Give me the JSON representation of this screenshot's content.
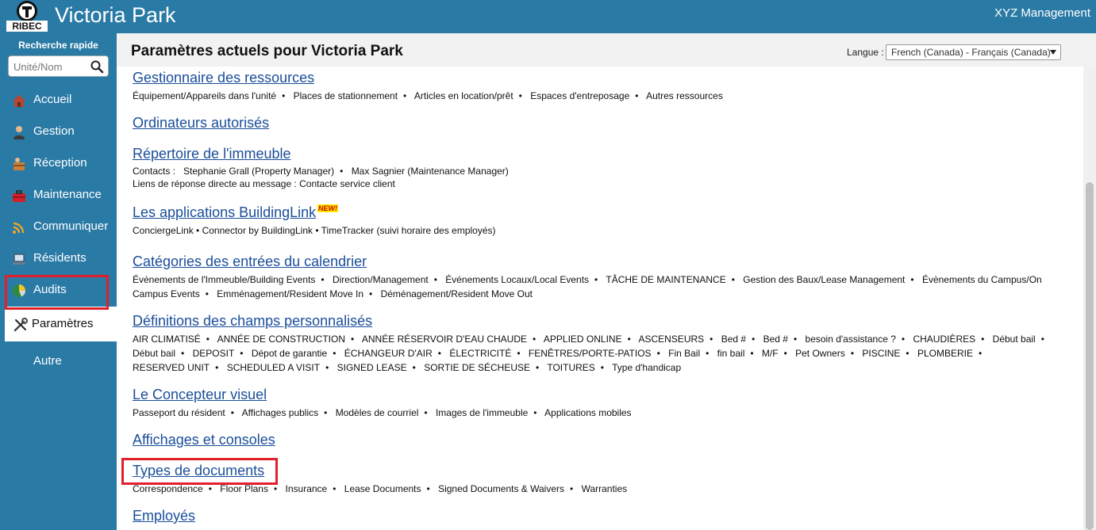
{
  "header": {
    "logo_text": "RIBEC",
    "title": "Victoria Park",
    "management": "XYZ Management"
  },
  "sidebar": {
    "quick_search_label": "Recherche rapide",
    "search_placeholder": "Unité/Nom",
    "items": [
      {
        "label": "Accueil",
        "icon": "house-icon"
      },
      {
        "label": "Gestion",
        "icon": "person-icon"
      },
      {
        "label": "Réception",
        "icon": "package-icon"
      },
      {
        "label": "Maintenance",
        "icon": "toolbox-icon"
      },
      {
        "label": "Communiquer",
        "icon": "wifi-icon"
      },
      {
        "label": "Résidents",
        "icon": "laptop-icon"
      },
      {
        "label": "Audits",
        "icon": "pie-chart-icon"
      },
      {
        "label": "Paramètres",
        "icon": "tools-icon",
        "active": true
      },
      {
        "label": "Autre",
        "icon": ""
      }
    ]
  },
  "content": {
    "title": "Paramètres actuels pour Victoria Park",
    "language_label": "Langue :",
    "language_value": "French (Canada) - Français (Canada)",
    "sections": [
      {
        "title": "Gestionnaire des ressources",
        "items": [
          "Équipement/Appareils dans l'unité",
          "Places de stationnement",
          "Articles en location/prêt",
          "Espaces d'entreposage",
          "Autres ressources"
        ]
      },
      {
        "title": "Ordinateurs autorisés",
        "items": []
      },
      {
        "title": "Répertoire de l'immeuble",
        "contacts_label": "Contacts :",
        "contacts": [
          "Stephanie Grall (Property Manager)",
          "Max Sagnier (Maintenance Manager)"
        ],
        "reply_links": "Liens de réponse directe au message : Contacte service client"
      },
      {
        "title": "Les applications BuildingLink",
        "badge": "NEW!",
        "items": [
          "ConciergeLink",
          "Connector by BuildingLink",
          "TimeTracker (suivi horaire des employés)"
        ]
      },
      {
        "title": "Catégories des entrées du calendrier",
        "items": [
          "Événements de l'Immeuble/Building Events",
          "Direction/Management",
          "Événements Locaux/Local Events",
          "TÂCHE DE MAINTENANCE",
          "Gestion des Baux/Lease Management",
          "Évènements du Campus/On Campus Events",
          "Emménagement/Resident Move In",
          "Déménagement/Resident Move Out"
        ]
      },
      {
        "title": "Définitions des champs personnalisés",
        "items": [
          "AIR CLIMATISÉ",
          "ANNÉE DE CONSTRUCTION",
          "ANNÉE RÉSERVOIR D'EAU CHAUDE",
          "APPLIED ONLINE",
          "ASCENSEURS",
          "Bed #",
          "Bed #",
          "besoin d'assistance ?",
          "CHAUDIÈRES",
          "Début bail",
          "Début bail",
          "DEPOSIT",
          "Dépot de garantie",
          "ÉCHANGEUR D'AIR",
          "ÉLECTRICITÉ",
          "FENÊTRES/PORTE-PATIOS",
          "Fin Bail",
          "fin bail",
          "M/F",
          "Pet Owners",
          "PISCINE",
          "PLOMBERIE",
          "RESERVED UNIT",
          "SCHEDULED A VISIT",
          "SIGNED LEASE",
          "SORTIE DE SÉCHEUSE",
          "TOITURES",
          "Type d'handicap"
        ]
      },
      {
        "title": "Le Concepteur visuel",
        "items": [
          "Passeport du résident",
          "Affichages publics",
          "Modèles de courriel",
          "Images de l'immeuble",
          "Applications mobiles"
        ]
      },
      {
        "title": "Affichages et consoles",
        "items": []
      },
      {
        "title": "Types de documents",
        "items": [
          "Correspondence",
          "Floor Plans",
          "Insurance",
          "Lease Documents",
          "Signed Documents & Waivers",
          "Warranties"
        ]
      },
      {
        "title": "Employés",
        "items": []
      }
    ]
  },
  "colors": {
    "header_bg": "#2a7aa6",
    "link": "#1a4e9a",
    "highlight": "#e0202a"
  }
}
